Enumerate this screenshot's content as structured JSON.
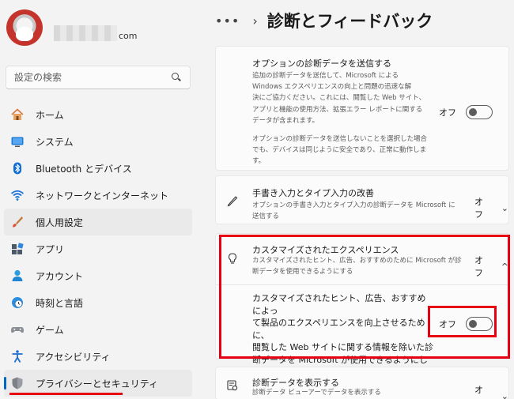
{
  "profile": {
    "email_suffix": "com"
  },
  "search": {
    "placeholder": "設定の検索"
  },
  "sidebar": {
    "items": [
      {
        "label": "ホーム",
        "icon": "home-icon"
      },
      {
        "label": "システム",
        "icon": "system-icon"
      },
      {
        "label": "Bluetooth とデバイス",
        "icon": "bluetooth-icon"
      },
      {
        "label": "ネットワークとインターネット",
        "icon": "wifi-icon"
      },
      {
        "label": "個人用設定",
        "icon": "brush-icon"
      },
      {
        "label": "アプリ",
        "icon": "apps-icon"
      },
      {
        "label": "アカウント",
        "icon": "account-icon"
      },
      {
        "label": "時刻と言語",
        "icon": "clock-globe-icon"
      },
      {
        "label": "ゲーム",
        "icon": "gamepad-icon"
      },
      {
        "label": "アクセシビリティ",
        "icon": "accessibility-icon"
      },
      {
        "label": "プライバシーとセキュリティ",
        "icon": "shield-icon"
      }
    ]
  },
  "header": {
    "more": "•••",
    "separator": "›",
    "title": "診断とフィードバック"
  },
  "optional_data": {
    "title": "オプションの診断データを送信する",
    "desc_lines": [
      "追加の診断データを送信して、Microsoft による",
      "Windows エクスペリエンスの向上と問題の迅速な解",
      "決にご協力ください。これには、閲覧した Web サイト、",
      "アプリと機能の使用方法、拡張エラー レポートに関する",
      "データが含まれます。"
    ],
    "desc2_lines": [
      "オプションの診断データを送信しないことを選択した場合",
      "でも、デバイスは同じように安全であり、正常に動作しま",
      "す。"
    ],
    "toggle_label": "オフ"
  },
  "inking": {
    "title": "手書き入力とタイプ入力の改善",
    "desc_lines": [
      "オプションの手書き入力とタイプ入力の診断データを Microsoft に",
      "送信する"
    ],
    "value": "オフ",
    "chevron": "⌄"
  },
  "tailored": {
    "title": "カスタマイズされたエクスペリエンス",
    "desc_lines": [
      "カスタマイズされたヒント、広告、おすすめのために Microsoft が診",
      "断データを使用できるようにする"
    ],
    "value": "オフ",
    "chevron": "^",
    "sub_lines": [
      "カスタマイズされたヒント、広告、おすすめによっ",
      "て製品のエクスペリエンスを向上させるために、",
      "閲覧した Web サイトに関する情報を除いた診",
      "断データを Microsoft が使用できるようにしま",
      "す。"
    ],
    "toggle_label": "オフ"
  },
  "view_data": {
    "title": "診断データを表示する",
    "desc": "診断データ ビューアーでデータを表示する",
    "value": "オン",
    "chevron": "⌄"
  }
}
